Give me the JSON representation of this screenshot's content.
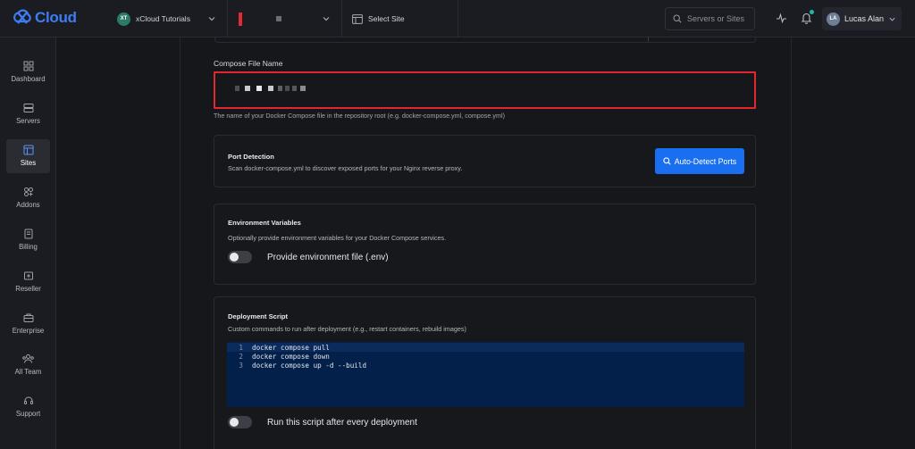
{
  "app": {
    "name": "Cloud"
  },
  "topbar": {
    "team_initials": "XT",
    "team_name": "xCloud Tutorials",
    "site_selector": "Select Site",
    "search_placeholder": "Servers or Sites",
    "user_initials": "LA",
    "user_name": "Lucas Alan"
  },
  "sidebar": {
    "items": [
      {
        "label": "Dashboard",
        "icon": "dashboard-icon",
        "active": false
      },
      {
        "label": "Servers",
        "icon": "servers-icon",
        "active": false
      },
      {
        "label": "Sites",
        "icon": "sites-icon",
        "active": true
      },
      {
        "label": "Addons",
        "icon": "addons-icon",
        "active": false
      },
      {
        "label": "Billing",
        "icon": "billing-icon",
        "active": false
      },
      {
        "label": "Reseller",
        "icon": "reseller-icon",
        "active": false
      },
      {
        "label": "Enterprise",
        "icon": "enterprise-icon",
        "active": false
      },
      {
        "label": "All Team",
        "icon": "team-icon",
        "active": false
      },
      {
        "label": "Support",
        "icon": "support-icon",
        "active": false
      }
    ]
  },
  "compose": {
    "label": "Compose File Name",
    "hint": "The name of your Docker Compose file in the repository root (e.g. docker-compose.yml, compose.yml)"
  },
  "port_detection": {
    "title": "Port Detection",
    "description": "Scan docker-compose.yml to discover exposed ports for your Nginx reverse proxy.",
    "button_label": "Auto-Detect Ports"
  },
  "env_vars": {
    "title": "Environment Variables",
    "description": "Optionally provide environment variables for your Docker Compose services.",
    "toggle_label": "Provide environment file (.env)",
    "toggle_on": false
  },
  "deploy_script": {
    "title": "Deployment Script",
    "description": "Custom commands to run after deployment (e.g., restart containers, rebuild images)",
    "lines": [
      {
        "num": "1",
        "code": "docker compose pull"
      },
      {
        "num": "2",
        "code": "docker compose down"
      },
      {
        "num": "3",
        "code": "docker compose up -d --build"
      }
    ],
    "toggle_label": "Run this script after every deployment",
    "toggle_on": false
  },
  "colors": {
    "accent": "#1a6ff0",
    "highlight_border": "#e3262f",
    "editor_bg": "#03204a"
  }
}
